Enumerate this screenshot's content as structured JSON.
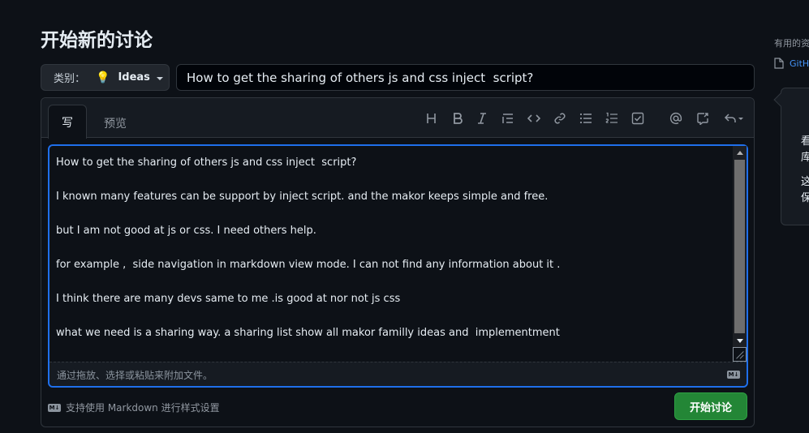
{
  "page": {
    "title": "开始新的讨论"
  },
  "category": {
    "prefix": "类别：",
    "icon": "bulb-icon",
    "value": "Ideas"
  },
  "title_input": {
    "value": "How to get the sharing of others js and css inject  script?"
  },
  "tabs": {
    "write": "写",
    "preview": "预览"
  },
  "toolbar": {
    "items": [
      "heading-icon",
      "bold-icon",
      "italic-icon",
      "quote-icon",
      "code-icon",
      "link-icon",
      "unordered-list-icon",
      "ordered-list-icon",
      "task-list-icon",
      "mention-icon",
      "cross-reference-icon",
      "reply-icon"
    ]
  },
  "body": {
    "value": "How to get the sharing of others js and css inject  script?\n\nI known many features can be support by inject script. and the makor keeps simple and free.\n\nbut I am not good at js or css. I need others help.\n\nfor example ,  side navigation in markdown view mode. I can not find any information about it .\n\nI think there are many devs same to me .is good at nor not js css\n\nwhat we need is a sharing way. a sharing list show all makor familly ideas and  implementment"
  },
  "attach": {
    "text": "通过拖放、选择或粘贴来附加文件。",
    "badge": "M↓"
  },
  "footer": {
    "badge": "M↓",
    "note": "支持使用 Markdown 进行样式设置"
  },
  "submit": {
    "label": "开始讨论"
  },
  "sidebar": {
    "heading": "有用的资",
    "link": "GitH"
  },
  "popover": {
    "line1": "看",
    "line2": "库",
    "line3": "这",
    "line4": "保"
  },
  "colors": {
    "background": "#0d1117",
    "accent_blue": "#1f6feb",
    "button_green": "#238636",
    "link_blue": "#4493f8"
  }
}
